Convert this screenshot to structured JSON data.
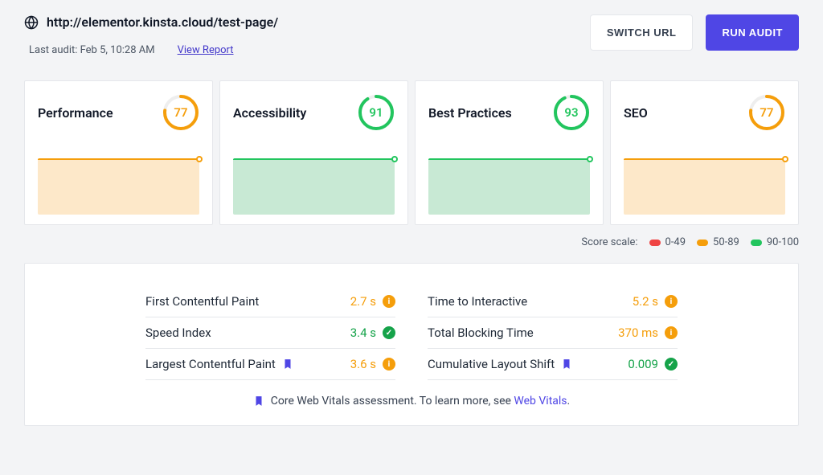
{
  "header": {
    "url": "http://elementor.kinsta.cloud/test-page/",
    "last_audit_label": "Last audit: Feb 5, 10:28 AM",
    "view_report": "View Report",
    "switch_url_btn": "SWITCH URL",
    "run_audit_btn": "RUN AUDIT"
  },
  "cards": [
    {
      "title": "Performance",
      "score": "77",
      "color": "orange"
    },
    {
      "title": "Accessibility",
      "score": "91",
      "color": "green"
    },
    {
      "title": "Best Practices",
      "score": "93",
      "color": "green"
    },
    {
      "title": "SEO",
      "score": "77",
      "color": "orange"
    }
  ],
  "scale": {
    "label": "Score scale:",
    "ranges": [
      "0-49",
      "50-89",
      "90-100"
    ]
  },
  "metrics": {
    "left": [
      {
        "label": "First Contentful Paint",
        "value": "2.7 s",
        "status": "orange",
        "bookmark": false
      },
      {
        "label": "Speed Index",
        "value": "3.4 s",
        "status": "green",
        "bookmark": false
      },
      {
        "label": "Largest Contentful Paint",
        "value": "3.6 s",
        "status": "orange",
        "bookmark": true
      }
    ],
    "right": [
      {
        "label": "Time to Interactive",
        "value": "5.2 s",
        "status": "orange",
        "bookmark": false
      },
      {
        "label": "Total Blocking Time",
        "value": "370 ms",
        "status": "orange",
        "bookmark": false
      },
      {
        "label": "Cumulative Layout Shift",
        "value": "0.009",
        "status": "green",
        "bookmark": true
      }
    ]
  },
  "footer": {
    "text": "Core Web Vitals assessment. To learn more, see ",
    "link_text": "Web Vitals",
    "suffix": "."
  },
  "colors": {
    "orange": "#f59e0b",
    "green": "#22c55e",
    "red": "#ef4444",
    "primary": "#4f46e5"
  }
}
